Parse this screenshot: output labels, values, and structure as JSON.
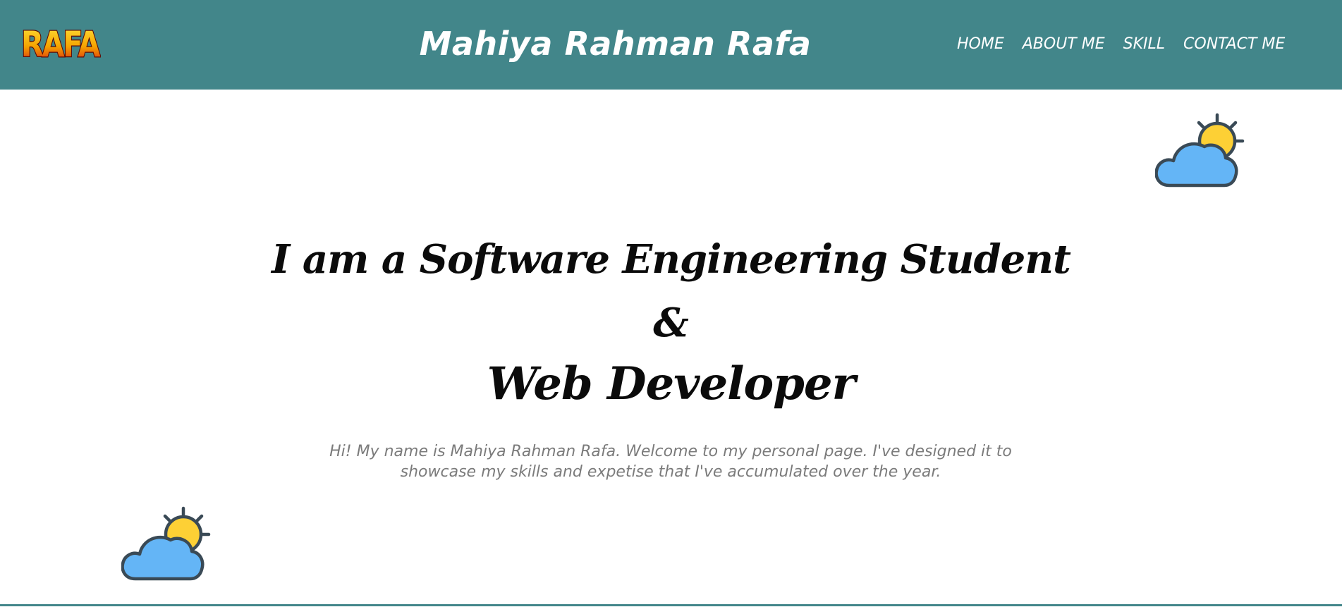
{
  "header": {
    "logo_text": "RAFA",
    "title": "Mahiya Rahman Rafa",
    "nav": [
      {
        "label": "HOME"
      },
      {
        "label": "ABOUT ME"
      },
      {
        "label": "SKILL"
      },
      {
        "label": "CONTACT ME"
      }
    ]
  },
  "hero": {
    "line1": "I am a Software Engineering Student",
    "line2": "&",
    "line3": "Web Developer",
    "intro_line1": "Hi! My name is Mahiya Rahman Rafa. Welcome to my personal page. I've designed it to",
    "intro_line2": "showcase my skills and expetise that I've accumulated over the year."
  },
  "decorations": {
    "weather_icon_right": "partly-cloudy-icon",
    "weather_icon_left": "partly-cloudy-icon"
  },
  "colors": {
    "header_bg": "#42868a",
    "heading_text": "#0b0b0b",
    "intro_text": "#7b7b7b",
    "cloud": "#64b5f6",
    "sun": "#fdd035"
  }
}
